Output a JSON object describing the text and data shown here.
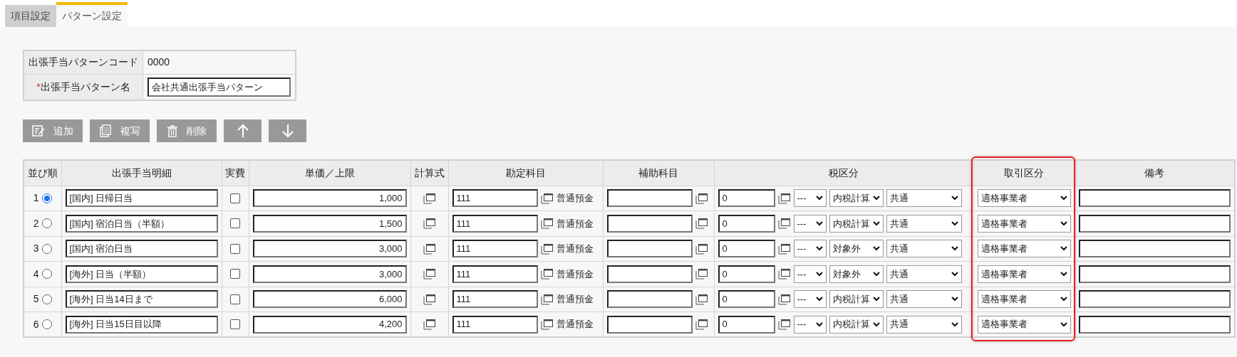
{
  "tabs": [
    {
      "label": "項目設定",
      "selected": false
    },
    {
      "label": "パターン設定",
      "selected": true
    }
  ],
  "info": {
    "code_label": "出張手当パターンコード",
    "code_value": "0000",
    "required_mark": "*",
    "name_label": "出張手当パターン名",
    "name_value": "会社共通出張手当パターン"
  },
  "buttons": [
    {
      "kind": "add",
      "label": "追加"
    },
    {
      "kind": "copy",
      "label": "複写"
    },
    {
      "kind": "delete",
      "label": "削除"
    },
    {
      "kind": "up"
    },
    {
      "kind": "down"
    }
  ],
  "table": {
    "columns": [
      {
        "label": "並び順",
        "highlighted": false
      },
      {
        "label": "出張手当明細",
        "highlighted": false
      },
      {
        "label": "実費",
        "highlighted": false
      },
      {
        "label": "単価／上限",
        "highlighted": false
      },
      {
        "label": "計算式",
        "highlighted": false
      },
      {
        "label": "勘定科目",
        "highlighted": false
      },
      {
        "label": "補助科目",
        "highlighted": false
      },
      {
        "label": "税区分",
        "highlighted": false
      },
      {
        "label": "取引区分",
        "highlighted": true
      },
      {
        "label": "備考",
        "highlighted": false
      }
    ],
    "rows": [
      {
        "order": "1",
        "selected": true,
        "detail": "[国内] 日帰日当",
        "actual": false,
        "amount": "1,000",
        "account_code": "111",
        "account_name": "普通預金",
        "tax_code": "0",
        "tax_rate": "---",
        "tax_calc": "内税計算",
        "tax_scope": "共通",
        "transaction": "適格事業者"
      },
      {
        "order": "2",
        "selected": false,
        "detail": "[国内] 宿泊日当（半額）",
        "actual": false,
        "amount": "1,500",
        "account_code": "111",
        "account_name": "普通預金",
        "tax_code": "0",
        "tax_rate": "---",
        "tax_calc": "内税計算",
        "tax_scope": "共通",
        "transaction": "適格事業者"
      },
      {
        "order": "3",
        "selected": false,
        "detail": "[国内] 宿泊日当",
        "actual": false,
        "amount": "3,000",
        "account_code": "111",
        "account_name": "普通預金",
        "tax_code": "0",
        "tax_rate": "---",
        "tax_calc": "対象外",
        "tax_scope": "共通",
        "transaction": "適格事業者"
      },
      {
        "order": "4",
        "selected": false,
        "detail": "[海外] 日当（半額）",
        "actual": false,
        "amount": "3,000",
        "account_code": "111",
        "account_name": "普通預金",
        "tax_code": "0",
        "tax_rate": "---",
        "tax_calc": "対象外",
        "tax_scope": "共通",
        "transaction": "適格事業者"
      },
      {
        "order": "5",
        "selected": false,
        "detail": "[海外] 日当14日まで",
        "actual": false,
        "amount": "6,000",
        "account_code": "111",
        "account_name": "普通預金",
        "tax_code": "0",
        "tax_rate": "---",
        "tax_calc": "内税計算",
        "tax_scope": "共通",
        "transaction": "適格事業者"
      },
      {
        "order": "6",
        "selected": false,
        "detail": "[海外] 日当15日目以降",
        "actual": false,
        "amount": "4,200",
        "account_code": "111",
        "account_name": "普通預金",
        "tax_code": "0",
        "tax_rate": "---",
        "tax_calc": "内税計算",
        "tax_scope": "共通",
        "transaction": "適格事業者"
      }
    ]
  }
}
